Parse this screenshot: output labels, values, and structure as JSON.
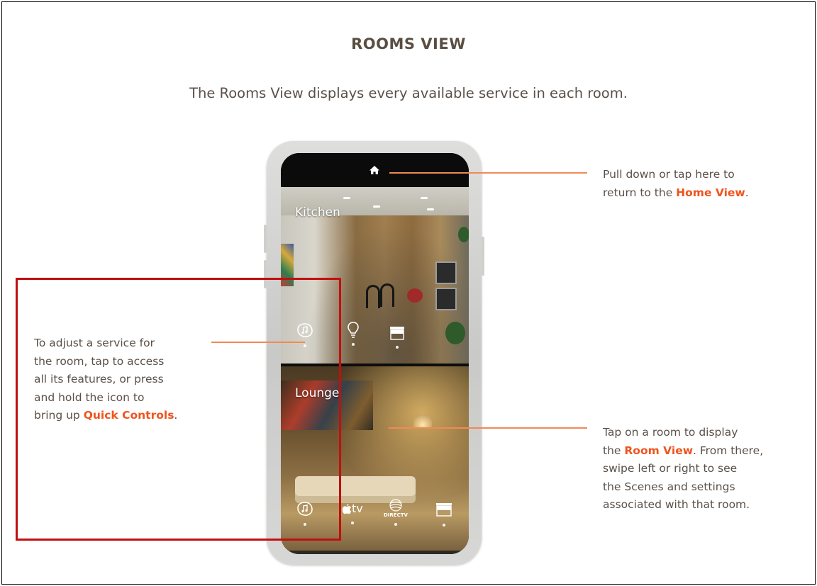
{
  "page": {
    "title": "ROOMS VIEW",
    "subtitle": "The Rooms View displays every available service in each room."
  },
  "callouts": {
    "home": {
      "line1": "Pull down or tap here to",
      "line2_prefix": "return to the ",
      "line2_highlight": "Home View",
      "line2_suffix": "."
    },
    "service": {
      "line1": "To adjust a service for",
      "line2": "the room, tap to access",
      "line3": "all its features, or press",
      "line4": "and hold the icon to",
      "line5_prefix": "bring up ",
      "line5_highlight": "Quick Controls",
      "line5_suffix": "."
    },
    "room": {
      "line1": "Tap on a room to display",
      "line2_prefix": "the ",
      "line2_highlight": "Room View",
      "line2_suffix": ". From there,",
      "line3": "swipe left or right to see",
      "line4": "the Scenes and settings",
      "line5": "associated with that room."
    }
  },
  "phone": {
    "rooms": [
      {
        "name": "Kitchen",
        "services": [
          "music-icon",
          "lightbulb-icon",
          "shades-icon"
        ]
      },
      {
        "name": "Lounge",
        "services": [
          "music-icon",
          "appletv-icon",
          "directv-icon",
          "shades-icon"
        ],
        "tv_label": "tv",
        "directv_label": "DIRECTV"
      }
    ]
  },
  "colors": {
    "highlight": "#f0541e",
    "leader_line": "#f08a55",
    "annotation_box": "#c10f0f",
    "body_text": "#5a5048"
  }
}
